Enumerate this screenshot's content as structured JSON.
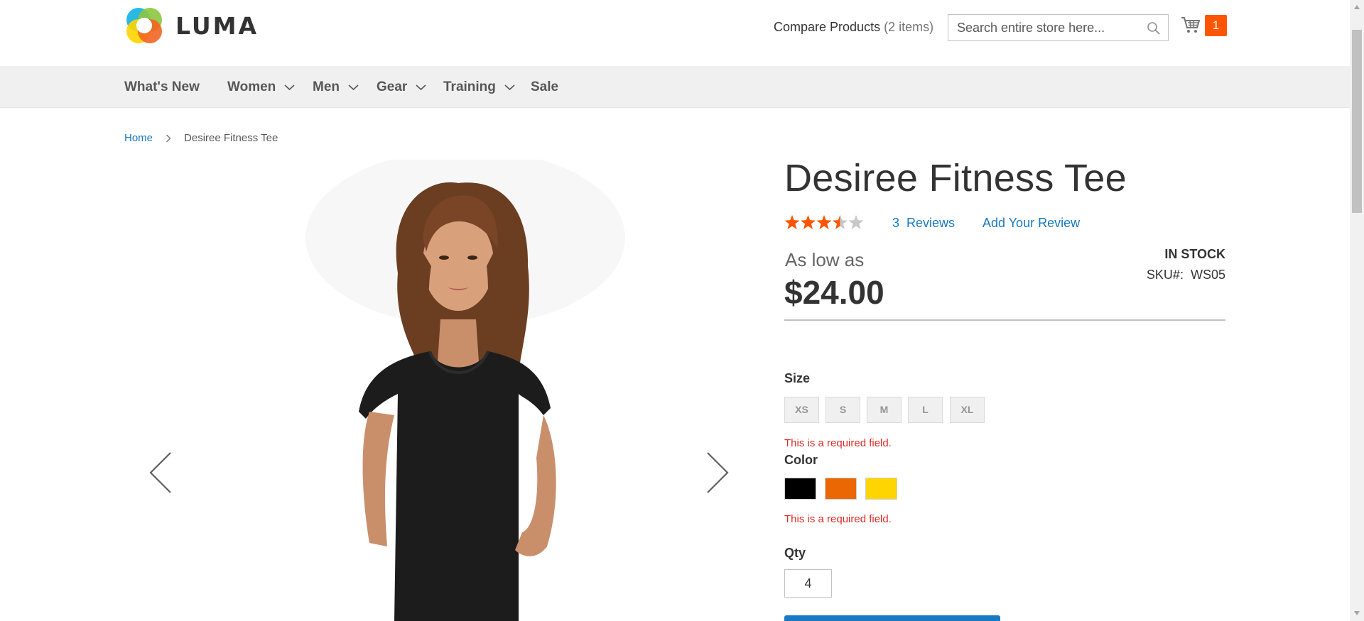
{
  "header": {
    "logo_text": "LUMA",
    "compare_label": "Compare Products",
    "compare_count": "(2 items)",
    "search_placeholder": "Search entire store here...",
    "cart_count": "1"
  },
  "nav": {
    "items": [
      {
        "label": "What's New",
        "has_dropdown": false
      },
      {
        "label": "Women",
        "has_dropdown": true
      },
      {
        "label": "Men",
        "has_dropdown": true
      },
      {
        "label": "Gear",
        "has_dropdown": true
      },
      {
        "label": "Training",
        "has_dropdown": true
      },
      {
        "label": "Sale",
        "has_dropdown": false
      }
    ]
  },
  "breadcrumb": {
    "home": "Home",
    "current": "Desiree Fitness Tee"
  },
  "product": {
    "title": "Desiree Fitness Tee",
    "rating_fraction": 0.7,
    "reviews_count": "3",
    "reviews_label": "Reviews",
    "add_review_label": "Add Your Review",
    "price_prefix": "As low as",
    "price": "$24.00",
    "stock_status": "IN STOCK",
    "sku_label": "SKU#:",
    "sku_value": "WS05",
    "size_label": "Size",
    "sizes": [
      "XS",
      "S",
      "M",
      "L",
      "XL"
    ],
    "size_error": "This is a required field.",
    "color_label": "Color",
    "colors": [
      "#000000",
      "#eb6703",
      "#ffd500"
    ],
    "color_error": "This is a required field.",
    "qty_label": "Qty",
    "qty_value": "4"
  },
  "colors": {
    "accent": "#1979c3",
    "star": "#ff5501",
    "error": "#e02b27"
  }
}
